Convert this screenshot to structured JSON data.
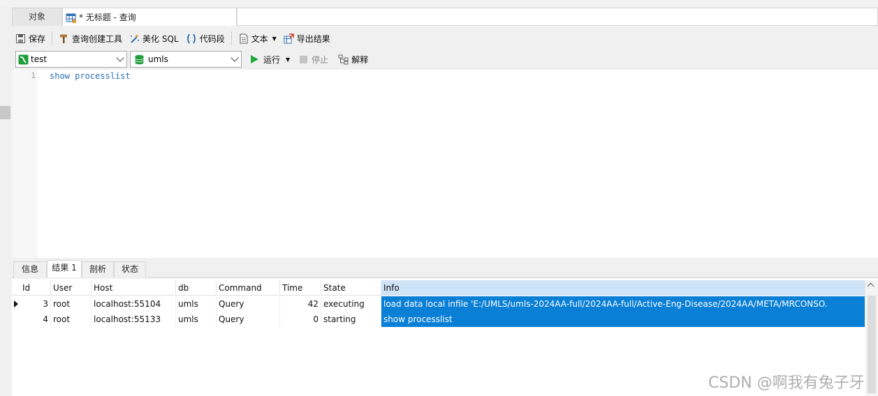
{
  "tabs": {
    "objects_label": "对象",
    "query_label": "* 无标题 - 查询"
  },
  "toolbar": {
    "save": "保存",
    "query_builder": "查询创建工具",
    "beautify_sql": "美化 SQL",
    "snippet": "代码段",
    "text": "文本",
    "export_result": "导出结果",
    "run": "运行",
    "stop": "停止",
    "explain": "解释"
  },
  "connection": {
    "selected": "test"
  },
  "database": {
    "selected": "umls"
  },
  "editor": {
    "line_number": "1",
    "code": "show processlist"
  },
  "result_tabs": [
    "信息",
    "结果 1",
    "剖析",
    "状态"
  ],
  "grid": {
    "columns": [
      "Id",
      "User",
      "Host",
      "db",
      "Command",
      "Time",
      "State",
      "Info"
    ],
    "rows": [
      [
        "3",
        "root",
        "localhost:55104",
        "umls",
        "Query",
        "42",
        "executing",
        "load data local infile 'E:/UMLS/umls-2024AA-full/2024AA-full/Active-Eng-Disease/2024AA/META/MRCONSO."
      ],
      [
        "4",
        "root",
        "localhost:55133",
        "umls",
        "Query",
        "0",
        "starting",
        "show processlist"
      ]
    ]
  },
  "watermark": "CSDN @啊我有兔子牙",
  "colors": {
    "selection": "#0a7fd6",
    "header_selected": "#cfe3f7",
    "code": "#2a6fb4",
    "run_green": "#1faa3a"
  }
}
